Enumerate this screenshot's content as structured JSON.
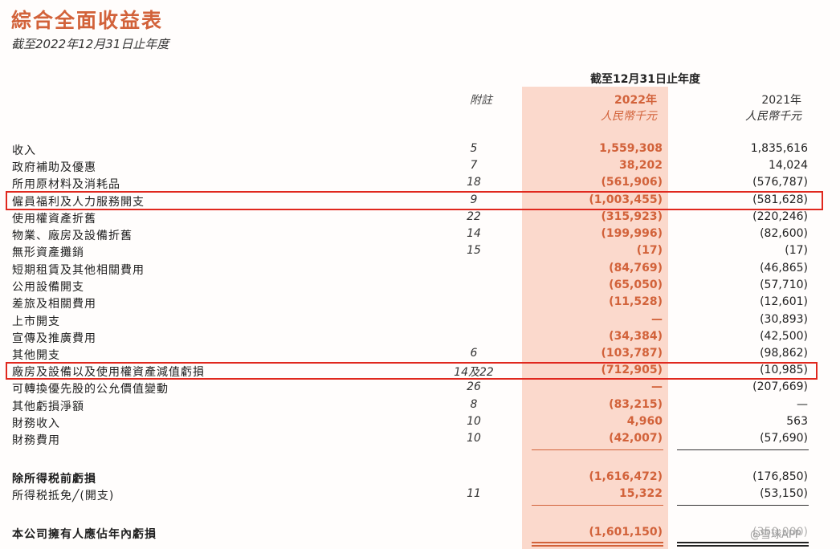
{
  "title": "綜合全面收益表",
  "subtitle": "截至2022年12月31日止年度",
  "header": {
    "period": "截至12月31日止年度",
    "note": "附註",
    "year_2022": "2022年",
    "unit_2022": "人民幣千元",
    "year_2021": "2021年",
    "unit_2021": "人民幣千元"
  },
  "rows": [
    {
      "label": "收入",
      "note": "5",
      "v2022": "1,559,308",
      "v2021": "1,835,616"
    },
    {
      "label": "政府補助及優惠",
      "note": "7",
      "v2022": "38,202",
      "v2021": "14,024"
    },
    {
      "label": "所用原材料及消耗品",
      "note": "18",
      "v2022": "(561,906)",
      "v2021": "(576,787)"
    },
    {
      "label": "僱員福利及人力服務開支",
      "note": "9",
      "v2022": "(1,003,455)",
      "v2021": "(581,628)"
    },
    {
      "label": "使用權資產折舊",
      "note": "22",
      "v2022": "(315,923)",
      "v2021": "(220,246)"
    },
    {
      "label": "物業、廠房及設備折舊",
      "note": "14",
      "v2022": "(199,996)",
      "v2021": "(82,600)"
    },
    {
      "label": "無形資產攤銷",
      "note": "15",
      "v2022": "(17)",
      "v2021": "(17)"
    },
    {
      "label": "短期租賃及其他相關費用",
      "note": "",
      "v2022": "(84,769)",
      "v2021": "(46,865)"
    },
    {
      "label": "公用設備開支",
      "note": "",
      "v2022": "(65,050)",
      "v2021": "(57,710)"
    },
    {
      "label": "差旅及相關費用",
      "note": "",
      "v2022": "(11,528)",
      "v2021": "(12,601)"
    },
    {
      "label": "上市開支",
      "note": "",
      "v2022": "—",
      "v2021": "(30,893)"
    },
    {
      "label": "宣傳及推廣費用",
      "note": "",
      "v2022": "(34,384)",
      "v2021": "(42,500)"
    },
    {
      "label": "其他開支",
      "note": "6",
      "v2022": "(103,787)",
      "v2021": "(98,862)"
    },
    {
      "label": "廠房及設備以及使用權資產減值虧損",
      "note": "14及22",
      "v2022": "(712,905)",
      "v2021": "(10,985)"
    },
    {
      "label": "可轉換優先股的公允價值變動",
      "note": "26",
      "v2022": "—",
      "v2021": "(207,669)"
    },
    {
      "label": "其他虧損淨額",
      "note": "8",
      "v2022": "(83,215)",
      "v2021": "—"
    },
    {
      "label": "財務收入",
      "note": "10",
      "v2022": "4,960",
      "v2021": "563"
    },
    {
      "label": "財務費用",
      "note": "10",
      "v2022": "(42,007)",
      "v2021": "(57,690)"
    }
  ],
  "subtotals": [
    {
      "label": "除所得税前虧損",
      "note": "",
      "v2022": "(1,616,472)",
      "v2021": "(176,850)"
    },
    {
      "label": "所得税抵免╱(開支)",
      "note": "11",
      "v2022": "15,322",
      "v2021": "(53,150)"
    }
  ],
  "total": {
    "label": "本公司擁有人應佔年內虧損",
    "note": "",
    "v2022": "(1,601,150)",
    "v2021": "(350,000)"
  },
  "watermark": "@雪球APP",
  "colors": {
    "accent": "#d2623a",
    "band": "#fbd9cc",
    "highlight_box": "#e0281e"
  }
}
